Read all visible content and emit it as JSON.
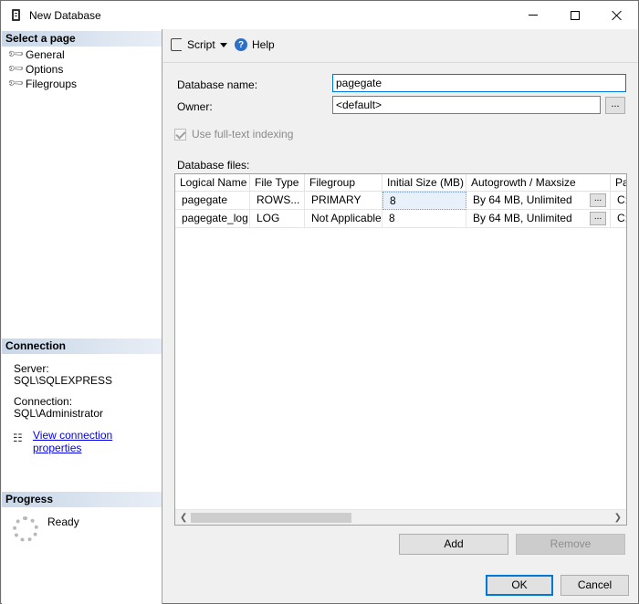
{
  "window": {
    "title": "New Database"
  },
  "left": {
    "select_page_header": "Select a page",
    "pages": [
      {
        "label": "General"
      },
      {
        "label": "Options"
      },
      {
        "label": "Filegroups"
      }
    ],
    "connection_header": "Connection",
    "server_label": "Server:",
    "server_value": "SQL\\SQLEXPRESS",
    "connection_label": "Connection:",
    "connection_value": "SQL\\Administrator",
    "view_properties_link": "View connection properties",
    "progress_header": "Progress",
    "progress_status": "Ready"
  },
  "toolbar": {
    "script_label": "Script",
    "help_label": "Help"
  },
  "form": {
    "database_name_label": "Database name:",
    "database_name_value": "pagegate",
    "owner_label": "Owner:",
    "owner_value": "<default>",
    "owner_browse": "...",
    "fulltext_label": "Use full-text indexing",
    "fulltext_checked": true,
    "database_files_label": "Database files:"
  },
  "files_table": {
    "columns": [
      "Logical Name",
      "File Type",
      "Filegroup",
      "Initial Size (MB)",
      "Autogrowth / Maxsize",
      "Pa"
    ],
    "rows": [
      {
        "logical_name": "pagegate",
        "file_type": "ROWS...",
        "filegroup": "PRIMARY",
        "initial_size": "8",
        "autogrowth": "By 64 MB, Unlimited",
        "path": "C:"
      },
      {
        "logical_name": "pagegate_log",
        "file_type": "LOG",
        "filegroup": "Not Applicable",
        "initial_size": "8",
        "autogrowth": "By 64 MB, Unlimited",
        "path": "C:"
      }
    ],
    "cell_button": "..."
  },
  "buttons": {
    "add": "Add",
    "remove": "Remove",
    "ok": "OK",
    "cancel": "Cancel"
  }
}
